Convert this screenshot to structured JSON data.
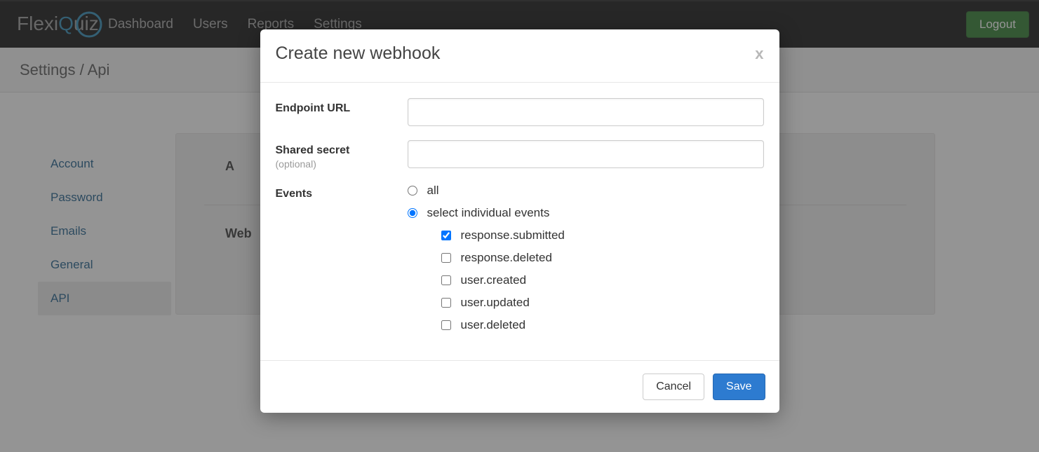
{
  "logo": {
    "part1": "Flexi",
    "part2": "Q",
    "part3": "uiz"
  },
  "nav": {
    "items": [
      "Dashboard",
      "Users",
      "Reports",
      "Settings"
    ],
    "logout": "Logout"
  },
  "breadcrumb": "Settings / Api",
  "sidebar": {
    "items": [
      {
        "label": "Account",
        "active": false
      },
      {
        "label": "Password",
        "active": false
      },
      {
        "label": "Emails",
        "active": false
      },
      {
        "label": "General",
        "active": false
      },
      {
        "label": "API",
        "active": true
      }
    ]
  },
  "panel": {
    "heading_a": "A",
    "heading_web": "Web"
  },
  "modal": {
    "title": "Create new webhook",
    "close": "x",
    "endpoint_label": "Endpoint URL",
    "endpoint_value": "",
    "secret_label": "Shared secret",
    "secret_optional": "(optional)",
    "secret_value": "",
    "events_label": "Events",
    "radio_all": "all",
    "radio_individual": "select individual events",
    "radio_selected": "individual",
    "event_options": [
      {
        "label": "response.submitted",
        "checked": true
      },
      {
        "label": "response.deleted",
        "checked": false
      },
      {
        "label": "user.created",
        "checked": false
      },
      {
        "label": "user.updated",
        "checked": false
      },
      {
        "label": "user.deleted",
        "checked": false
      }
    ],
    "cancel": "Cancel",
    "save": "Save"
  }
}
